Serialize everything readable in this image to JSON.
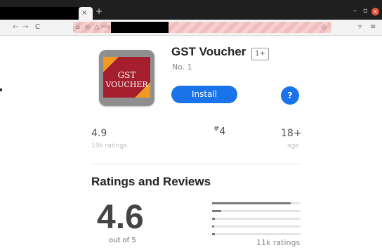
{
  "browser": {
    "tab_close_icon": "×",
    "new_tab_icon": "+",
    "window_controls": {
      "minimize": "–",
      "maximize": "▫",
      "close": "×"
    },
    "nav": {
      "back": "←",
      "forward": "→",
      "reload": "C"
    },
    "url_partial": "http",
    "bookmark_icon": "☆"
  },
  "app": {
    "title": "GST Voucher",
    "age_badge": "1+",
    "rank_text": "No. 1",
    "install_label": "Install",
    "help_label": "?",
    "icon_text_line1": "GST",
    "icon_text_line2": "VOUCHER"
  },
  "stats": {
    "rating": "4.9",
    "ratings_count": "19k ratings",
    "rank_prefix": "#",
    "rank_value": "4",
    "age": "18+",
    "age_label": "age"
  },
  "reviews": {
    "title": "Ratings and Reviews",
    "average": "4.6",
    "out_of": "out of 5",
    "count": "11k ratings",
    "distribution": [
      {
        "stars": 5,
        "fraction": 0.89
      },
      {
        "stars": 4,
        "fraction": 0.1
      },
      {
        "stars": 3,
        "fraction": 0.03
      },
      {
        "stars": 2,
        "fraction": 0.02
      },
      {
        "stars": 1,
        "fraction": 0.03
      }
    ]
  },
  "colors": {
    "accent": "#1a73e8",
    "icon_red": "#a41e2d",
    "icon_orange": "#f29a1f"
  }
}
